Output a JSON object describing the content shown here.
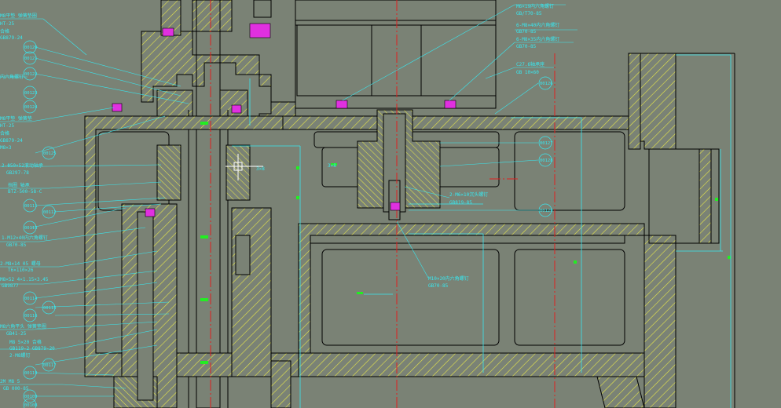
{
  "drawing": {
    "colors": {
      "background": "#7a8275",
      "outline": "#000000",
      "hatch": "#e8e84a",
      "leader": "#38e8f0",
      "centerline": "#e02020",
      "fastener": "#e030e0",
      "marker": "#22ee22"
    },
    "crosshair_icon": "crosshair-cursor-icon",
    "balloons": [
      "00120",
      "00121",
      "00122",
      "00123",
      "00124",
      "00125",
      "00126",
      "00127",
      "00128",
      "00129",
      "00130",
      "00131",
      "00132",
      "00111",
      "00112",
      "00113",
      "00114",
      "00115",
      "00116",
      "00117",
      "00118",
      "00119",
      "00109",
      "00110",
      "00108"
    ],
    "callouts": [
      {
        "id": "c1",
        "text": "M6×19内六角螺钉"
      },
      {
        "id": "c2",
        "text": "GB/T70-85"
      },
      {
        "id": "c3",
        "text": "M8×40内六角螺钉"
      },
      {
        "id": "c4",
        "text": "GB70-85"
      },
      {
        "id": "c5",
        "text": "6-M8×40内六角螺钉"
      },
      {
        "id": "c6",
        "text": "GB70-85"
      },
      {
        "id": "c7",
        "text": "6-M8×35内六角螺钉"
      },
      {
        "id": "c8",
        "text": "GB70-85"
      },
      {
        "id": "c9",
        "text": "C27.6轴承座"
      },
      {
        "id": "c10",
        "text": "GB 10×60"
      },
      {
        "id": "c11",
        "text": "M8平垫 弹簧垫圈"
      },
      {
        "id": "c12",
        "text": "HT-25"
      },
      {
        "id": "c13",
        "text": "合格"
      },
      {
        "id": "c14",
        "text": "GB879-24"
      },
      {
        "id": "c15",
        "text": "内六角螺钉"
      },
      {
        "id": "c16",
        "text": "M8平垫 弹簧垫"
      },
      {
        "id": "c17",
        "text": "HT-25"
      },
      {
        "id": "c18",
        "text": "合格"
      },
      {
        "id": "c19",
        "text": "GB879-24"
      },
      {
        "id": "c20",
        "text": "M8×3"
      },
      {
        "id": "c21",
        "text": "2-Φ50×52滚动轴承"
      },
      {
        "id": "c22",
        "text": "GB297-78"
      },
      {
        "id": "c23",
        "text": "挡圈 轴承"
      },
      {
        "id": "c24",
        "text": "BTZ-500-58-C"
      },
      {
        "id": "c25",
        "text": "1-M12×40内六角螺钉"
      },
      {
        "id": "c26",
        "text": "GB70-85"
      },
      {
        "id": "c27",
        "text": "2-M8×14 05 螺母"
      },
      {
        "id": "c28",
        "text": "T6×110×26"
      },
      {
        "id": "c29",
        "text": "M8×52 4×1.15×3.45"
      },
      {
        "id": "c30",
        "text": "GB9877"
      },
      {
        "id": "c31",
        "text": "M8六角平头 弹簧垫圈"
      },
      {
        "id": "c32",
        "text": "GB41-25"
      },
      {
        "id": "c33",
        "text": "M8 5×20 合格"
      },
      {
        "id": "c34",
        "text": "GB119-2 GB879-20"
      },
      {
        "id": "c35",
        "text": "2-M8螺钉"
      },
      {
        "id": "c36",
        "text": "2-M6×10沉头螺钉"
      },
      {
        "id": "c37",
        "text": "GB819-85"
      },
      {
        "id": "c38",
        "text": "M10×20内六角螺钉"
      },
      {
        "id": "c39",
        "text": "GB70-85"
      },
      {
        "id": "c40",
        "text": "M4 M8 螺栓"
      },
      {
        "id": "c41",
        "text": "2M M8 5"
      },
      {
        "id": "c42",
        "text": "GB 000-85"
      },
      {
        "id": "c43",
        "text": "3×8"
      },
      {
        "id": "c44",
        "text": "3×8"
      }
    ]
  }
}
